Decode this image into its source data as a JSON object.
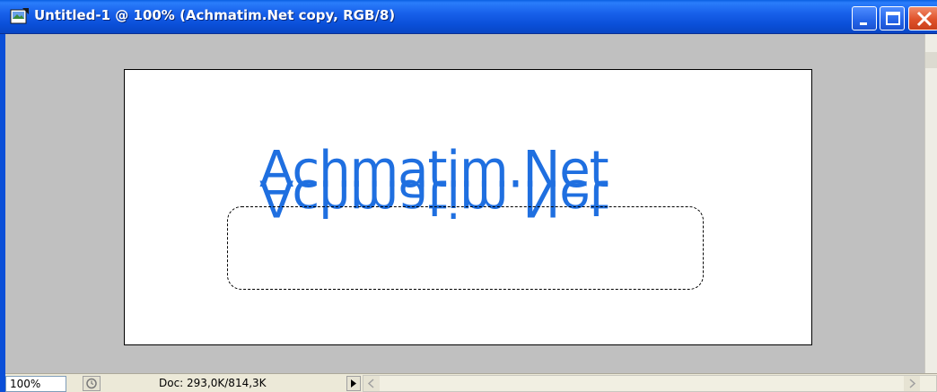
{
  "window": {
    "title": "Untitled-1 @ 100% (Achmatim.Net copy, RGB/8)",
    "icon": "photoshop-document-icon",
    "controls": [
      "minimize-icon",
      "maximize-icon",
      "close-icon"
    ]
  },
  "canvas": {
    "text": "Achmatim.Net",
    "reflection_text": "Achmatim.Net",
    "text_color": "#1f6fe0",
    "background": "#ffffff",
    "workspace_color": "#c0c0c0",
    "selection": "marquee-selection"
  },
  "statusbar": {
    "zoom": "100%",
    "doc_info": "Doc: 293,0K/814,3K",
    "menu_arrow": "triangle-right-icon"
  },
  "colors": {
    "titlebar": "#0a4fd8",
    "close_button": "#e0522a"
  }
}
